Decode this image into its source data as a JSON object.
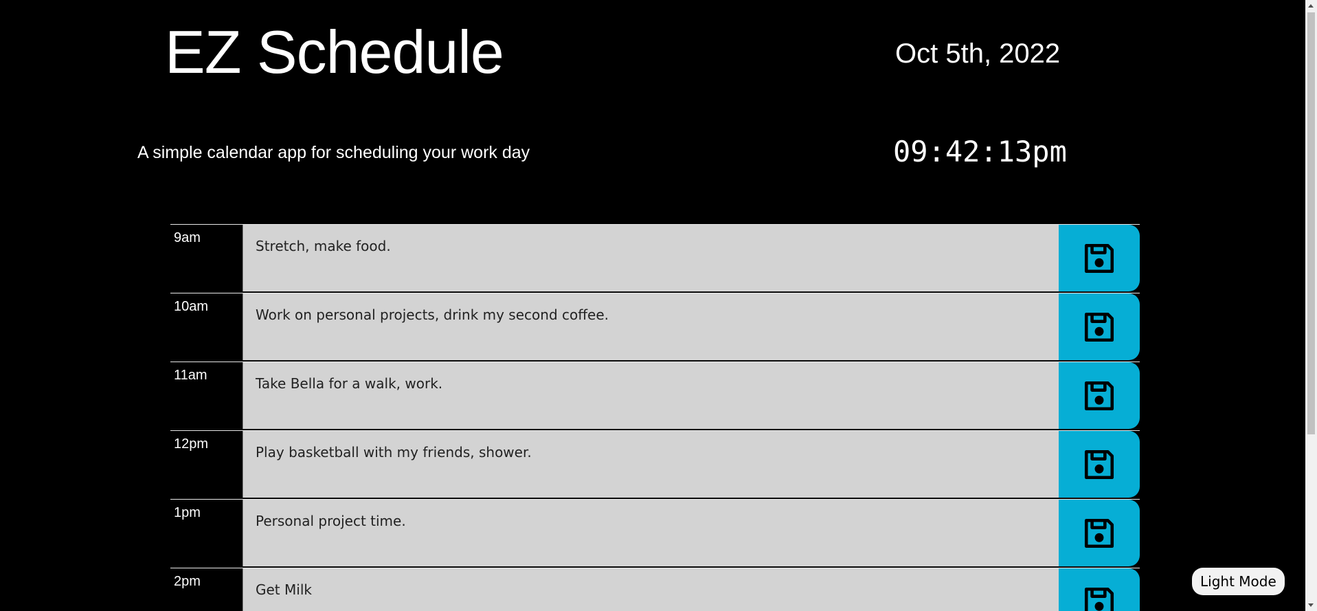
{
  "header": {
    "title": "EZ Schedule",
    "date": "Oct 5th, 2022",
    "subtitle": "A simple calendar app for scheduling your work day",
    "clock": "09:42:13pm"
  },
  "schedule": {
    "rows": [
      {
        "hour": "9am",
        "text": "Stretch, make food."
      },
      {
        "hour": "10am",
        "text": "Work on personal projects, drink my second coffee."
      },
      {
        "hour": "11am",
        "text": "Take Bella for a walk, work."
      },
      {
        "hour": "12pm",
        "text": "Play basketball with my friends, shower."
      },
      {
        "hour": "1pm",
        "text": "Personal project time."
      },
      {
        "hour": "2pm",
        "text": "Get Milk"
      }
    ],
    "save_icon": "floppy-disk-icon"
  },
  "controls": {
    "mode_toggle_label": "Light Mode"
  },
  "colors": {
    "background": "#000000",
    "row_bg": "#d3d3d3",
    "save_bg": "#06aed5",
    "text_light": "#ffffff"
  }
}
